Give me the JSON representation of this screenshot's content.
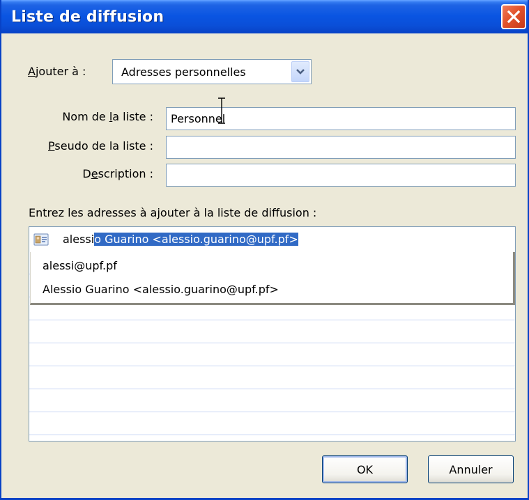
{
  "window": {
    "title": "Liste de diffusion",
    "close_icon": "close-icon"
  },
  "add_to": {
    "label_access": "A",
    "label_rest": "jouter à :",
    "selected": "Adresses personnelles"
  },
  "fields": {
    "name": {
      "label_pre": "Nom de ",
      "label_access": "l",
      "label_post": "a liste :",
      "value": "Personnel"
    },
    "nickname": {
      "label_access": "P",
      "label_post": "seudo de la liste :",
      "value": ""
    },
    "description": {
      "label_pre": "D",
      "label_access": "e",
      "label_post": "scription :",
      "value": ""
    }
  },
  "addresses": {
    "prompt": "Entrez les adresses à ajouter à la liste de diffusion :",
    "typed_text": "alessi",
    "autocomplete_suffix": "o Guarino <alessio.guarino@upf.pf>",
    "suggestions": [
      "alessi@upf.pf",
      "Alessio Guarino <alessio.guarino@upf.pf>"
    ]
  },
  "buttons": {
    "ok": "OK",
    "cancel": "Annuler"
  },
  "colors": {
    "title_bar": "#0a55e2",
    "dialog_bg": "#ece9d8",
    "selection": "#316ac5",
    "close_button": "#e2532c"
  }
}
